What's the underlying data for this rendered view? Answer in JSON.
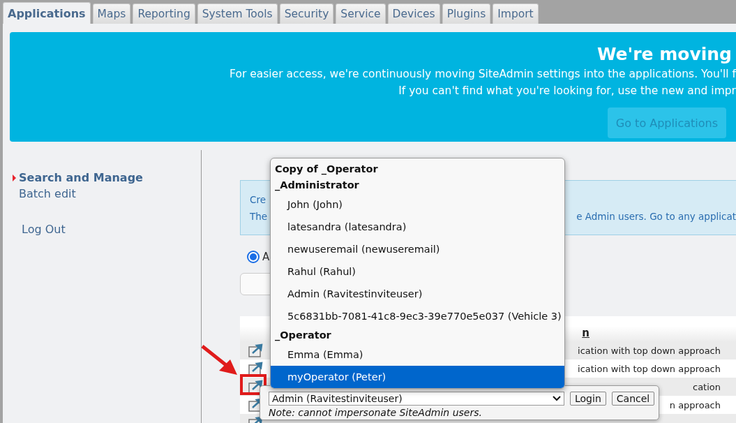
{
  "tabs": [
    {
      "label": "Applications",
      "selected": true
    },
    {
      "label": "Maps",
      "selected": false
    },
    {
      "label": "Reporting",
      "selected": false
    },
    {
      "label": "System Tools",
      "selected": false
    },
    {
      "label": "Security",
      "selected": false
    },
    {
      "label": "Service",
      "selected": false
    },
    {
      "label": "Devices",
      "selected": false
    },
    {
      "label": "Plugins",
      "selected": false
    },
    {
      "label": "Import",
      "selected": false
    }
  ],
  "banner": {
    "title": "We're moving",
    "lines": [
      "For easier access, we're continuously moving SiteAdmin settings into the applications. You'll f",
      "If you can't find what you're looking for, use the new and impr"
    ],
    "button": "Go to Applications"
  },
  "sidebar": {
    "items": [
      {
        "label": "Search and Manage",
        "selected": true
      },
      {
        "label": "Batch edit",
        "selected": false
      }
    ],
    "logout": "Log Out"
  },
  "info_box": {
    "line_1": [
      "Cre"
    ],
    "line_2": [
      "The",
      "e Admin users. Go to any applicat"
    ]
  },
  "filter": {
    "radio": {
      "label": "A",
      "selected": true
    }
  },
  "table": {
    "header": "n",
    "rows": [
      {
        "column_3": "ication with top down approach"
      },
      {
        "column_3": "ication with top down approach"
      },
      {
        "column_3": "cation"
      },
      {
        "column_3": "n approach"
      },
      {}
    ]
  },
  "impersonate": {
    "select_value": "Admin (Ravitestinviteuser)",
    "buttons": [
      "Login",
      "Cancel"
    ],
    "note": "Note: cannot impersonate SiteAdmin users."
  },
  "dropdown": {
    "groups": [
      {
        "label": "Copy of _Operator"
      },
      {
        "label": "_Administrator",
        "options": [
          {
            "label": "John (John)",
            "selected": false
          },
          {
            "label": "latesandra (latesandra)",
            "selected": false
          },
          {
            "label": "newuseremail (newuseremail)",
            "selected": false
          },
          {
            "label": "Rahul (Rahul)",
            "selected": false
          },
          {
            "label": "Admin (Ravitestinviteuser)",
            "selected": false
          },
          {
            "label": "5c6831bb-7081-41c8-9ec3-39e770e5e037 (Vehicle 3)",
            "selected": false
          }
        ]
      },
      {
        "label": "_Operator",
        "options": [
          {
            "label": "Emma (Emma)",
            "selected": false
          },
          {
            "label": "myOperator (Peter)",
            "selected": true
          }
        ]
      }
    ]
  }
}
